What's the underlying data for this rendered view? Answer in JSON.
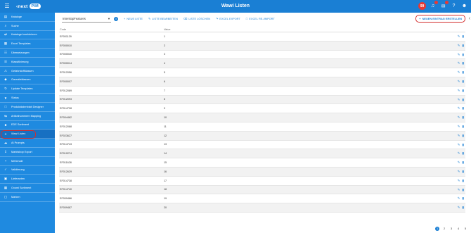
{
  "app": {
    "title": "Wawi Listen",
    "logo_prefix": "‹next",
    "logo_badge": "PIM"
  },
  "topbar": {
    "notification_badge": "99"
  },
  "sidebar": {
    "items": [
      {
        "label": "Kataloge",
        "icon": "book-icon",
        "glyph": "▤"
      },
      {
        "label": "Suche",
        "icon": "search-icon",
        "glyph": "⌕"
      },
      {
        "label": "Kataloge kombinieren",
        "icon": "merge-icon",
        "glyph": "⇄"
      },
      {
        "label": "Excel Templates",
        "icon": "table-icon",
        "glyph": "▦"
      },
      {
        "label": "Übersetzungen",
        "icon": "translate-icon",
        "glyph": "☷"
      },
      {
        "label": "Klassifizierung",
        "icon": "tree-icon",
        "glyph": "☰"
      },
      {
        "label": "Gefahrstoffklassen",
        "icon": "warning-icon",
        "glyph": "⚠"
      },
      {
        "label": "Garantieklassen",
        "icon": "shield-icon",
        "glyph": "◆"
      },
      {
        "label": "Update Templates",
        "icon": "refresh-icon",
        "glyph": "↻"
      },
      {
        "label": "Status",
        "icon": "filter-icon",
        "glyph": "▼"
      },
      {
        "label": "Produktdatenblatt Designer",
        "icon": "document-icon",
        "glyph": "□"
      },
      {
        "label": "Artikelnummern Mapping",
        "icon": "arrows-icon",
        "glyph": "⇆"
      },
      {
        "label": "EDE Sortiment",
        "icon": "folder-icon",
        "glyph": "■"
      },
      {
        "label": "Wawi Listen",
        "icon": "list-icon",
        "glyph": "≡"
      },
      {
        "label": "AI Prompts",
        "icon": "cloud-icon",
        "glyph": "☁"
      },
      {
        "label": "Marktshop Export",
        "icon": "export-icon",
        "glyph": "↥"
      },
      {
        "label": "Merkmale",
        "icon": "tag-icon",
        "glyph": "▪"
      },
      {
        "label": "Validierung",
        "icon": "check-icon",
        "glyph": "✓"
      },
      {
        "label": "Lieferanten",
        "icon": "truck-icon",
        "glyph": "▣"
      },
      {
        "label": "Oxomi Sortiment",
        "icon": "grid-icon",
        "glyph": "▦"
      },
      {
        "label": "Marken",
        "icon": "brand-icon",
        "glyph": "▢"
      }
    ],
    "active_index": 13
  },
  "toolbar": {
    "list_select_value": "InterstopFeatures",
    "new_list": "NEUE LISTE",
    "edit_list": "LISTE BEARBEITEN",
    "delete_list": "LISTE LÖSCHEN",
    "excel_export": "EXCEL EXPORT",
    "excel_reimport": "EXCEL RE-/IMPORT",
    "new_entry": "NEUEN EINTRAG ERSTELLEN"
  },
  "table": {
    "columns": [
      "Code",
      "Value"
    ],
    "rows": [
      {
        "code": "EF001139",
        "value": "1"
      },
      {
        "code": "EF000010",
        "value": "2"
      },
      {
        "code": "EF000040",
        "value": "3"
      },
      {
        "code": "EF000014",
        "value": "4"
      },
      {
        "code": "EF012056",
        "value": "5"
      },
      {
        "code": "EF000007",
        "value": "6"
      },
      {
        "code": "EF012089",
        "value": "7"
      },
      {
        "code": "EF012093",
        "value": "8"
      },
      {
        "code": "EF014728",
        "value": "9"
      },
      {
        "code": "EF004462",
        "value": "10"
      },
      {
        "code": "EF012088",
        "value": "11"
      },
      {
        "code": "EF023627",
        "value": "12"
      },
      {
        "code": "EF014743",
        "value": "13"
      },
      {
        "code": "EF010274",
        "value": "14"
      },
      {
        "code": "EF011628",
        "value": "15"
      },
      {
        "code": "EF012629",
        "value": "16"
      },
      {
        "code": "EF014738",
        "value": "17"
      },
      {
        "code": "EF014740",
        "value": "18"
      },
      {
        "code": "EF009486",
        "value": "19"
      },
      {
        "code": "EF009487",
        "value": "20"
      }
    ]
  },
  "pagination": {
    "pages": [
      "1",
      "2",
      "3",
      "4",
      "5"
    ],
    "current": "1"
  },
  "colors": {
    "primary": "#1a7fd4",
    "sidebar": "#1f8ae0",
    "highlight": "#d32f2f"
  }
}
